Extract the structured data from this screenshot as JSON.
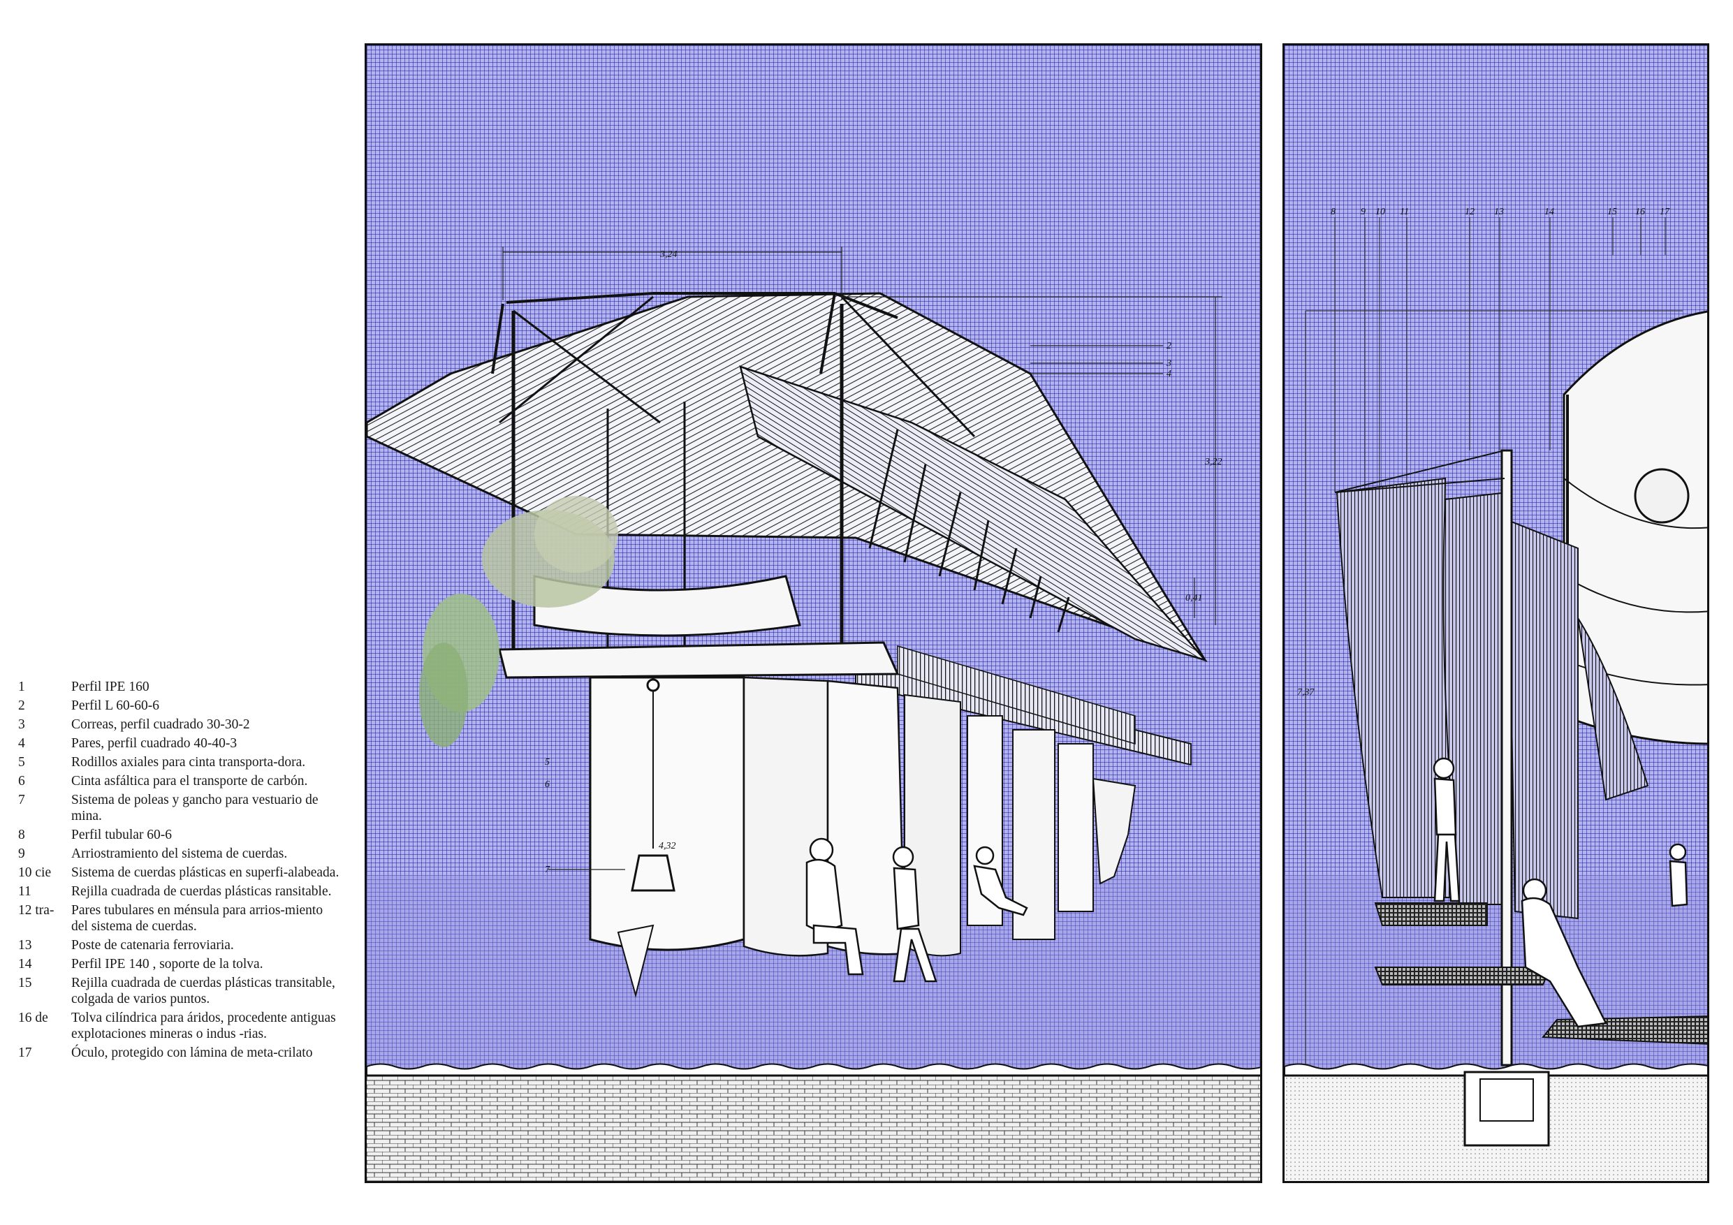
{
  "legend": [
    {
      "num": "1",
      "text": "Perfil IPE 160"
    },
    {
      "num": "2",
      "text": "Perfil L 60-60-6"
    },
    {
      "num": "3",
      "text": "Correas, perfil cuadrado 30-30-2"
    },
    {
      "num": "4",
      "text": "Pares, perfil cuadrado  40-40-3"
    },
    {
      "num": "5",
      "text": "Rodillos axiales para cinta transporta-dora."
    },
    {
      "num": "6",
      "text": "Cinta asfáltica para el transporte de carbón."
    },
    {
      "num": "7",
      "text": "Sistema de poleas y gancho para vestuario de mina."
    },
    {
      "num": "8",
      "text": "Perfil tubular 60-6"
    },
    {
      "num": "9",
      "text": "Arriostramiento del sistema de cuerdas."
    },
    {
      "num": "10 cie",
      "text": "Sistema de cuerdas plásticas en superfi-alabeada."
    },
    {
      "num": "11",
      "text": "Rejilla cuadrada de cuerdas plásticas ransitable."
    },
    {
      "num": "12 tra-",
      "text": "Pares tubulares en ménsula para arrios-miento del sistema de cuerdas."
    },
    {
      "num": "13",
      "text": "Poste de catenaria ferroviaria."
    },
    {
      "num": "14",
      "text": "Perfil IPE 140 , soporte de la tolva."
    },
    {
      "num": "15",
      "text": "Rejilla cuadrada de cuerdas plásticas transitable, colgada de varios puntos."
    },
    {
      "num": "16 de",
      "text": "Tolva cilíndrica para áridos, procedente antiguas explotaciones mineras  o indus -rias."
    },
    {
      "num": "17",
      "text": "Óculo, protegido con lámina de meta-crilato"
    }
  ],
  "left_section": {
    "dimensions": {
      "span_top": "3,24",
      "height_right": "3,22",
      "depth_small": "0,41",
      "hook_height": "4,32"
    },
    "callouts": [
      "2",
      "3",
      "4",
      "5",
      "6",
      "7"
    ]
  },
  "right_section": {
    "top_callouts": [
      "8",
      "9",
      "10",
      "11",
      "12",
      "13",
      "14",
      "15",
      "16",
      "17"
    ],
    "height_dim": "7,37"
  },
  "colors": {
    "panel_blue": "#b3b3ef",
    "grid_line": "#1e1ea0",
    "ink": "#111111",
    "foliage": "#9fbf88"
  }
}
